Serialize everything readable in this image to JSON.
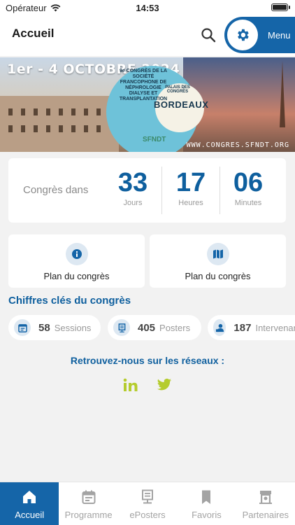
{
  "status_bar": {
    "carrier": "Opérateur",
    "time": "14:53"
  },
  "header": {
    "title": "Accueil",
    "menu_label": "Menu",
    "icons": {
      "search": "search-icon",
      "menu": "gear-icon"
    }
  },
  "banner": {
    "dates": "1er - 4 OCTOBRE 2024",
    "congress_line": "9e CONGRÈS DE LA SOCIÉTÉ FRANCOPHONE DE NÉPHROLOGIE DIALYSE ET TRANSPLANTATION",
    "venue_line": "PALAIS DES CONGRÈS",
    "city": "BORDEAUX",
    "logo_text": "SFNDT",
    "url": "WWW.CONGRES.SFNDT.ORG"
  },
  "countdown": {
    "lead": "Congrès dans",
    "days": {
      "value": "33",
      "unit": "Jours"
    },
    "hours": {
      "value": "17",
      "unit": "Heures"
    },
    "minutes": {
      "value": "06",
      "unit": "Minutes"
    }
  },
  "cards": [
    {
      "label": "Plan du congrès",
      "icon": "info-icon"
    },
    {
      "label": "Plan du congrès",
      "icon": "map-icon"
    }
  ],
  "key_figures": {
    "title": "Chiffres clés du congrès",
    "items": [
      {
        "value": "58",
        "label": "Sessions",
        "icon": "calendar-icon"
      },
      {
        "value": "405",
        "label": "Posters",
        "icon": "poster-icon"
      },
      {
        "value": "187",
        "label": "Intervenants",
        "icon": "speaker-icon"
      }
    ]
  },
  "social": {
    "title": "Retrouvez-nous sur les réseaux :",
    "links": [
      "linkedin-icon",
      "twitter-icon"
    ],
    "color": "#b5cc2e"
  },
  "tabbar": {
    "tabs": [
      {
        "label": "Accueil",
        "icon": "home-icon",
        "active": true
      },
      {
        "label": "Programme",
        "icon": "calendar-icon",
        "active": false
      },
      {
        "label": "ePosters",
        "icon": "eposter-icon",
        "active": false
      },
      {
        "label": "Favoris",
        "icon": "bookmark-icon",
        "active": false
      },
      {
        "label": "Partenaires",
        "icon": "partners-icon",
        "active": false
      }
    ]
  },
  "colors": {
    "primary": "#1565a8",
    "accent_text": "#0e5f9e",
    "icon_bg": "#dde8f2"
  }
}
